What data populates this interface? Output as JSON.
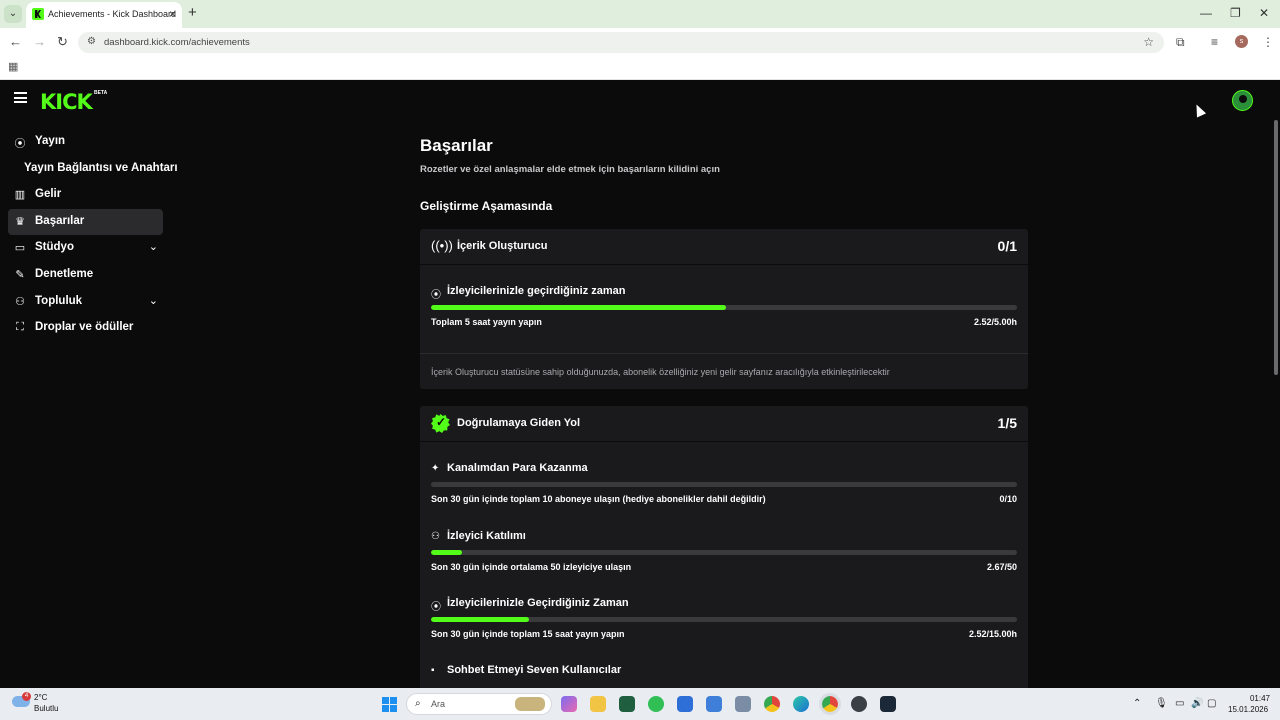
{
  "browser": {
    "tab_title": "Achievements - Kick Dashboard",
    "url": "dashboard.kick.com/achievements",
    "profile_initial": "s"
  },
  "header": {
    "logo": "KICK",
    "beta": "BETA"
  },
  "sidebar": {
    "items": [
      {
        "label": "Yayın",
        "icon": "broadcast-icon"
      },
      {
        "label": "Yayın Bağlantısı ve Anahtarı"
      },
      {
        "label": "Gelir",
        "icon": "chart-icon"
      },
      {
        "label": "Başarılar",
        "icon": "trophy-icon"
      },
      {
        "label": "Stüdyo",
        "icon": "studio-icon"
      },
      {
        "label": "Denetleme",
        "icon": "wrench-icon"
      },
      {
        "label": "Topluluk",
        "icon": "community-icon"
      },
      {
        "label": "Droplar ve ödüller",
        "icon": "gift-icon"
      }
    ]
  },
  "main": {
    "title": "Başarılar",
    "subtitle": "Rozetler ve özel anlaşmalar elde etmek için başarıların kilidini açın",
    "section_title": "Geliştirme Aşamasında",
    "cards": [
      {
        "title": "İçerik Oluşturucu",
        "count": "0/1",
        "goals": [
          {
            "title": "İzleyicilerinizle geçirdiğiniz zaman",
            "desc": "Toplam 5 saat yayın yapın",
            "value": "2.52/5.00h",
            "progress": 0.504
          }
        ],
        "footer": "İçerik Oluşturucu statüsüne sahip olduğunuzda, abonelik özelliğiniz yeni gelir sayfanız aracılığıyla etkinleştirilecektir"
      },
      {
        "title": "Doğrulamaya Giden Yol",
        "count": "1/5",
        "goals": [
          {
            "title": "Kanalımdan Para Kazanma",
            "desc": "Son 30 gün içinde toplam 10 aboneye ulaşın (hediye abonelikler dahil değildir)",
            "value": "0/10",
            "progress": 0.0
          },
          {
            "title": "İzleyici Katılımı",
            "desc": "Son 30 gün içinde ortalama 50 izleyiciye ulaşın",
            "value": "2.67/50",
            "progress": 0.053
          },
          {
            "title": "İzleyicilerinizle Geçirdiğiniz Zaman",
            "desc": "Son 30 gün içinde toplam 15 saat yayın yapın",
            "value": "2.52/15.00h",
            "progress": 0.168
          },
          {
            "title": "Sohbet Etmeyi Seven Kullanıcılar"
          }
        ]
      }
    ]
  },
  "taskbar": {
    "weather_badge": "4",
    "temperature": "2°C",
    "condition": "Bulutlu",
    "search_placeholder": "Ara",
    "time": "01:47",
    "date": "15.01.2026"
  },
  "colors": {
    "accent": "#53fc18",
    "background": "#0b0b0c",
    "card": "#1a1a1c"
  }
}
